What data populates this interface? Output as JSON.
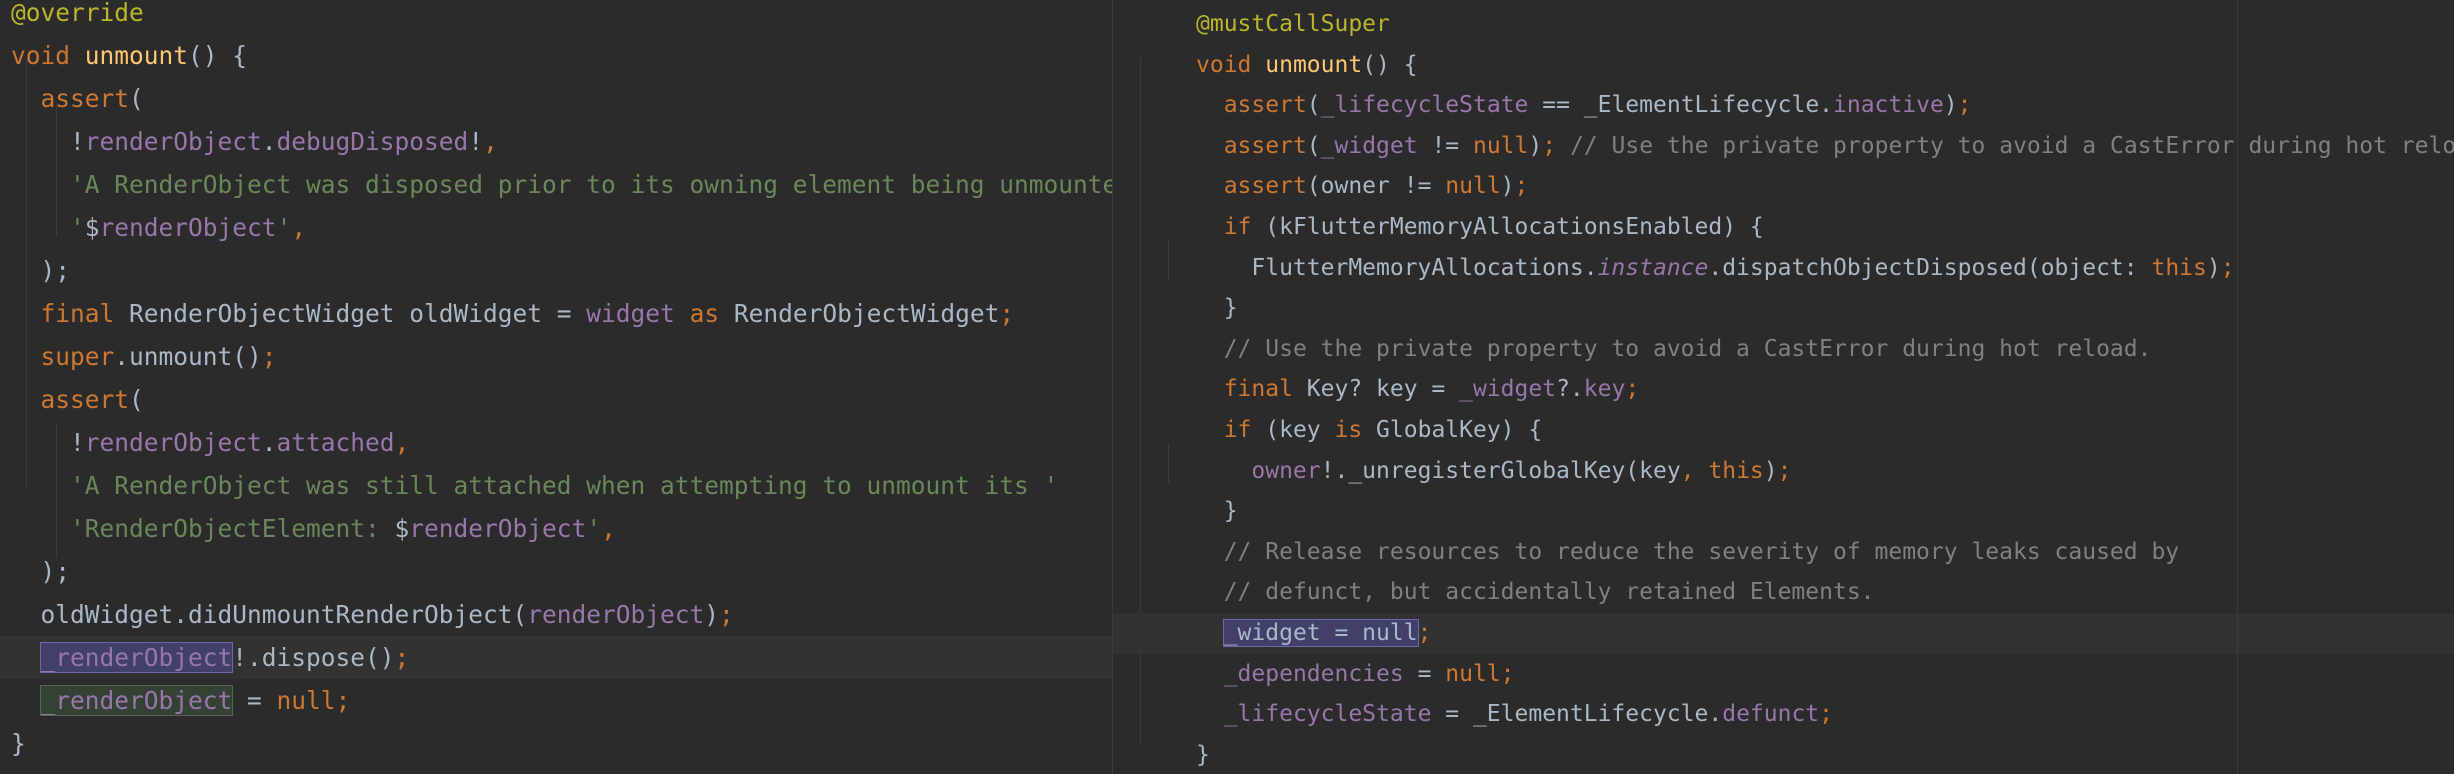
{
  "left_pane": {
    "lines": [
      {
        "tokens": [
          {
            "t": "@override",
            "c": "ann"
          }
        ]
      },
      {
        "tokens": [
          {
            "t": "void",
            "c": "kw"
          },
          {
            "t": " "
          },
          {
            "t": "unmount",
            "c": "fn"
          },
          {
            "t": "() {"
          }
        ]
      },
      {
        "tokens": [
          {
            "t": "  "
          },
          {
            "t": "assert",
            "c": "kw"
          },
          {
            "t": "("
          }
        ]
      },
      {
        "tokens": [
          {
            "t": "    !"
          },
          {
            "t": "renderObject",
            "c": "fld"
          },
          {
            "t": "."
          },
          {
            "t": "debugDisposed",
            "c": "fld"
          },
          {
            "t": "!"
          },
          {
            "t": ",",
            "c": "kw"
          }
        ]
      },
      {
        "tokens": [
          {
            "t": "    "
          },
          {
            "t": "'A RenderObject was disposed prior to its owning element being unmounted: '",
            "c": "str"
          }
        ]
      },
      {
        "tokens": [
          {
            "t": "    "
          },
          {
            "t": "'",
            "c": "str"
          },
          {
            "t": "$"
          },
          {
            "t": "renderObject",
            "c": "fld"
          },
          {
            "t": "'",
            "c": "str"
          },
          {
            "t": ",",
            "c": "kw"
          }
        ]
      },
      {
        "tokens": [
          {
            "t": "  );"
          }
        ]
      },
      {
        "tokens": [
          {
            "t": "  "
          },
          {
            "t": "final",
            "c": "kw"
          },
          {
            "t": " RenderObjectWidget oldWidget = "
          },
          {
            "t": "widget",
            "c": "fld"
          },
          {
            "t": " "
          },
          {
            "t": "as",
            "c": "kw"
          },
          {
            "t": " RenderObjectWidget"
          },
          {
            "t": ";",
            "c": "kw"
          }
        ]
      },
      {
        "tokens": [
          {
            "t": "  "
          },
          {
            "t": "super",
            "c": "kw"
          },
          {
            "t": ".unmount()"
          },
          {
            "t": ";",
            "c": "kw"
          }
        ]
      },
      {
        "tokens": [
          {
            "t": "  "
          },
          {
            "t": "assert",
            "c": "kw"
          },
          {
            "t": "("
          }
        ]
      },
      {
        "tokens": [
          {
            "t": "    !"
          },
          {
            "t": "renderObject",
            "c": "fld"
          },
          {
            "t": "."
          },
          {
            "t": "attached",
            "c": "fld"
          },
          {
            "t": ",",
            "c": "kw"
          }
        ]
      },
      {
        "tokens": [
          {
            "t": "    "
          },
          {
            "t": "'A RenderObject was still attached when attempting to unmount its '",
            "c": "str"
          }
        ]
      },
      {
        "tokens": [
          {
            "t": "    "
          },
          {
            "t": "'RenderObjectElement: ",
            "c": "str"
          },
          {
            "t": "$"
          },
          {
            "t": "renderObject",
            "c": "fld"
          },
          {
            "t": "'",
            "c": "str"
          },
          {
            "t": ",",
            "c": "kw"
          }
        ]
      },
      {
        "tokens": [
          {
            "t": "  );"
          }
        ]
      },
      {
        "tokens": [
          {
            "t": "  oldWidget.didUnmountRenderObject("
          },
          {
            "t": "renderObject",
            "c": "fld"
          },
          {
            "t": ")"
          },
          {
            "t": ";",
            "c": "kw"
          }
        ]
      },
      {
        "current": true,
        "tokens": [
          {
            "t": "  "
          },
          {
            "t": "_renderObject",
            "c": "fld hl-write"
          },
          {
            "t": "!.dispose()"
          },
          {
            "t": ";",
            "c": "kw"
          }
        ]
      },
      {
        "tokens": [
          {
            "t": "  "
          },
          {
            "t": "_renderObject",
            "c": "fld hl-read"
          },
          {
            "t": " = "
          },
          {
            "t": "null",
            "c": "kw"
          },
          {
            "t": ";",
            "c": "kw"
          }
        ]
      },
      {
        "tokens": [
          {
            "t": "}"
          }
        ]
      }
    ]
  },
  "right_pane": {
    "lines": [
      {
        "tokens": [
          {
            "t": "@mustCallSuper",
            "c": "ann"
          }
        ]
      },
      {
        "tokens": [
          {
            "t": "void",
            "c": "kw"
          },
          {
            "t": " "
          },
          {
            "t": "unmount",
            "c": "fn"
          },
          {
            "t": "() {"
          }
        ]
      },
      {
        "tokens": [
          {
            "t": "  "
          },
          {
            "t": "assert",
            "c": "kw"
          },
          {
            "t": "("
          },
          {
            "t": "_lifecycleState",
            "c": "fld"
          },
          {
            "t": " == _ElementLifecycle."
          },
          {
            "t": "inactive",
            "c": "fld"
          },
          {
            "t": ")"
          },
          {
            "t": ";",
            "c": "kw"
          }
        ]
      },
      {
        "tokens": [
          {
            "t": "  "
          },
          {
            "t": "assert",
            "c": "kw"
          },
          {
            "t": "("
          },
          {
            "t": "_widget",
            "c": "fld"
          },
          {
            "t": " != "
          },
          {
            "t": "null",
            "c": "kw"
          },
          {
            "t": ")"
          },
          {
            "t": ";",
            "c": "kw"
          },
          {
            "t": " "
          },
          {
            "t": "// Use the private property to avoid a CastError during hot reload.",
            "c": "cmt"
          }
        ]
      },
      {
        "tokens": [
          {
            "t": "  "
          },
          {
            "t": "assert",
            "c": "kw"
          },
          {
            "t": "(owner != "
          },
          {
            "t": "null",
            "c": "kw"
          },
          {
            "t": ")"
          },
          {
            "t": ";",
            "c": "kw"
          }
        ]
      },
      {
        "tokens": [
          {
            "t": "  "
          },
          {
            "t": "if",
            "c": "kw"
          },
          {
            "t": " (kFlutterMemoryAllocationsEnabled) {"
          }
        ]
      },
      {
        "tokens": [
          {
            "t": "    FlutterMemoryAllocations."
          },
          {
            "t": "instance",
            "c": "ital"
          },
          {
            "t": ".dispatchObjectDisposed(object: "
          },
          {
            "t": "this",
            "c": "kw"
          },
          {
            "t": ")"
          },
          {
            "t": ";",
            "c": "kw"
          }
        ]
      },
      {
        "tokens": [
          {
            "t": "  }"
          }
        ]
      },
      {
        "tokens": [
          {
            "t": "  "
          },
          {
            "t": "// Use the private property to avoid a CastError during hot reload.",
            "c": "cmt"
          }
        ]
      },
      {
        "tokens": [
          {
            "t": "  "
          },
          {
            "t": "final",
            "c": "kw"
          },
          {
            "t": " Key? key = "
          },
          {
            "t": "_widget",
            "c": "fld"
          },
          {
            "t": "?."
          },
          {
            "t": "key",
            "c": "fld"
          },
          {
            "t": ";",
            "c": "kw"
          }
        ]
      },
      {
        "tokens": [
          {
            "t": "  "
          },
          {
            "t": "if",
            "c": "kw"
          },
          {
            "t": " (key "
          },
          {
            "t": "is",
            "c": "kw"
          },
          {
            "t": " GlobalKey) {"
          }
        ]
      },
      {
        "tokens": [
          {
            "t": "    "
          },
          {
            "t": "owner",
            "c": "fld"
          },
          {
            "t": "!._unregisterGlobalKey(key"
          },
          {
            "t": ",",
            "c": "kw"
          },
          {
            "t": " "
          },
          {
            "t": "this",
            "c": "kw"
          },
          {
            "t": ")"
          },
          {
            "t": ";",
            "c": "kw"
          }
        ]
      },
      {
        "tokens": [
          {
            "t": "  }"
          }
        ]
      },
      {
        "tokens": [
          {
            "t": "  "
          },
          {
            "t": "// Release resources to reduce the severity of memory leaks caused by",
            "c": "cmt"
          }
        ]
      },
      {
        "tokens": [
          {
            "t": "  "
          },
          {
            "t": "// defunct, but accidentally retained Elements.",
            "c": "cmt"
          }
        ]
      },
      {
        "current": true,
        "tokens": [
          {
            "t": "  "
          },
          {
            "t": "_widget = null",
            "c": "hl-write"
          },
          {
            "t": ";",
            "c": "kw"
          }
        ]
      },
      {
        "tokens": [
          {
            "t": "  "
          },
          {
            "t": "_dependencies",
            "c": "fld"
          },
          {
            "t": " = "
          },
          {
            "t": "null",
            "c": "kw"
          },
          {
            "t": ";",
            "c": "kw"
          }
        ]
      },
      {
        "tokens": [
          {
            "t": "  "
          },
          {
            "t": "_lifecycleState",
            "c": "fld"
          },
          {
            "t": " = _ElementLifecycle."
          },
          {
            "t": "defunct",
            "c": "fld"
          },
          {
            "t": ";",
            "c": "kw"
          }
        ]
      },
      {
        "tokens": [
          {
            "t": "}"
          }
        ]
      }
    ]
  }
}
